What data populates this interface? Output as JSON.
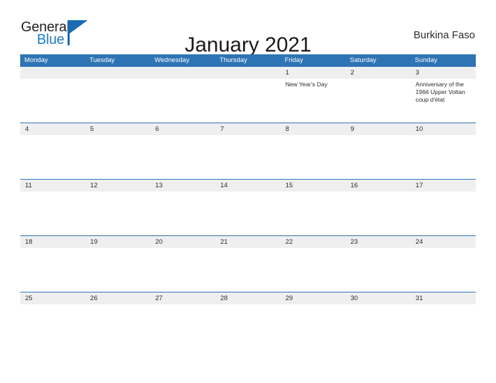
{
  "brand": {
    "name_part1": "General",
    "name_part2": "Blue",
    "flag_icon": "blue-flag-triangle",
    "color_dark": "#231f20",
    "color_blue": "#1b7ac4"
  },
  "header": {
    "title": "January 2021",
    "region": "Burkina Faso"
  },
  "colors": {
    "header_blue": "#2e74b5",
    "date_strip_gray": "#efefef",
    "text_dark": "#2b2b2b"
  },
  "weekdays": [
    "Monday",
    "Tuesday",
    "Wednesday",
    "Thursday",
    "Friday",
    "Saturday",
    "Sunday"
  ],
  "weeks": [
    {
      "days": [
        {
          "date": "",
          "event": ""
        },
        {
          "date": "",
          "event": ""
        },
        {
          "date": "",
          "event": ""
        },
        {
          "date": "",
          "event": ""
        },
        {
          "date": "1",
          "event": "New Year's Day"
        },
        {
          "date": "2",
          "event": ""
        },
        {
          "date": "3",
          "event": "Anniversary of the 1966 Upper Voltan coup d'état"
        }
      ]
    },
    {
      "days": [
        {
          "date": "4",
          "event": ""
        },
        {
          "date": "5",
          "event": ""
        },
        {
          "date": "6",
          "event": ""
        },
        {
          "date": "7",
          "event": ""
        },
        {
          "date": "8",
          "event": ""
        },
        {
          "date": "9",
          "event": ""
        },
        {
          "date": "10",
          "event": ""
        }
      ]
    },
    {
      "days": [
        {
          "date": "11",
          "event": ""
        },
        {
          "date": "12",
          "event": ""
        },
        {
          "date": "13",
          "event": ""
        },
        {
          "date": "14",
          "event": ""
        },
        {
          "date": "15",
          "event": ""
        },
        {
          "date": "16",
          "event": ""
        },
        {
          "date": "17",
          "event": ""
        }
      ]
    },
    {
      "days": [
        {
          "date": "18",
          "event": ""
        },
        {
          "date": "19",
          "event": ""
        },
        {
          "date": "20",
          "event": ""
        },
        {
          "date": "21",
          "event": ""
        },
        {
          "date": "22",
          "event": ""
        },
        {
          "date": "23",
          "event": ""
        },
        {
          "date": "24",
          "event": ""
        }
      ]
    },
    {
      "days": [
        {
          "date": "25",
          "event": ""
        },
        {
          "date": "26",
          "event": ""
        },
        {
          "date": "27",
          "event": ""
        },
        {
          "date": "28",
          "event": ""
        },
        {
          "date": "29",
          "event": ""
        },
        {
          "date": "30",
          "event": ""
        },
        {
          "date": "31",
          "event": ""
        }
      ]
    }
  ]
}
